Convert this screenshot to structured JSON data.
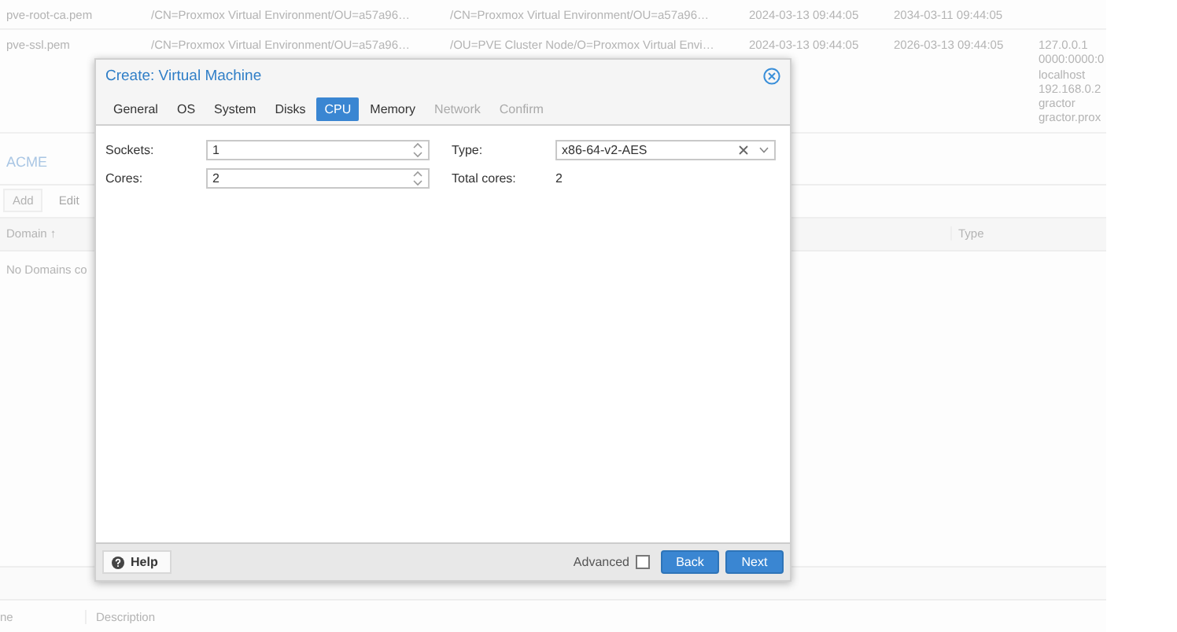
{
  "certificates": {
    "rows": [
      {
        "cells": [
          "pve-root-ca.pem",
          "/CN=Proxmox Virtual Environment/OU=a57a96…",
          "/CN=Proxmox Virtual Environment/OU=a57a96…",
          "2024-03-13 09:44:05",
          "2034-03-11 09:44:05"
        ],
        "extra_lines": []
      },
      {
        "cells": [
          "pve-ssl.pem",
          "/CN=Proxmox Virtual Environment/OU=a57a96…",
          "/OU=PVE Cluster Node/O=Proxmox Virtual Envi…",
          "2024-03-13 09:44:05",
          "2026-03-13 09:44:05"
        ],
        "extra_lines": [
          "127.0.0.1",
          "0000:0000:0",
          "localhost",
          "192.168.0.2",
          "gractor",
          "gractor.prox"
        ]
      }
    ]
  },
  "acme": {
    "title": "ACME",
    "buttons": [
      {
        "label": "Add",
        "disabled": false
      },
      {
        "label": "Edit",
        "disabled": true
      }
    ],
    "columns": [
      "Domain ↑",
      "Type"
    ],
    "empty_text": "No Domains co"
  },
  "bottom_grid": {
    "columns": [
      "ne",
      "Description"
    ]
  },
  "dialog": {
    "title": "Create: Virtual Machine",
    "tabs": [
      {
        "label": "General",
        "selected": false,
        "disabled": false
      },
      {
        "label": "OS",
        "selected": false,
        "disabled": false
      },
      {
        "label": "System",
        "selected": false,
        "disabled": false
      },
      {
        "label": "Disks",
        "selected": false,
        "disabled": false
      },
      {
        "label": "CPU",
        "selected": true,
        "disabled": false
      },
      {
        "label": "Memory",
        "selected": false,
        "disabled": false
      },
      {
        "label": "Network",
        "selected": false,
        "disabled": true
      },
      {
        "label": "Confirm",
        "selected": false,
        "disabled": true
      }
    ],
    "left_fields": [
      {
        "kind": "spinner",
        "label": "Sockets:",
        "value": "1"
      },
      {
        "kind": "spinner",
        "label": "Cores:",
        "value": "2"
      }
    ],
    "right_fields": [
      {
        "kind": "combo",
        "label": "Type:",
        "value": "x86-64-v2-AES"
      },
      {
        "kind": "display",
        "label": "Total cores:",
        "value": "2"
      }
    ],
    "footer": {
      "help": "Help",
      "advanced": {
        "label": "Advanced",
        "checked": false
      },
      "back": "Back",
      "next": "Next"
    }
  }
}
